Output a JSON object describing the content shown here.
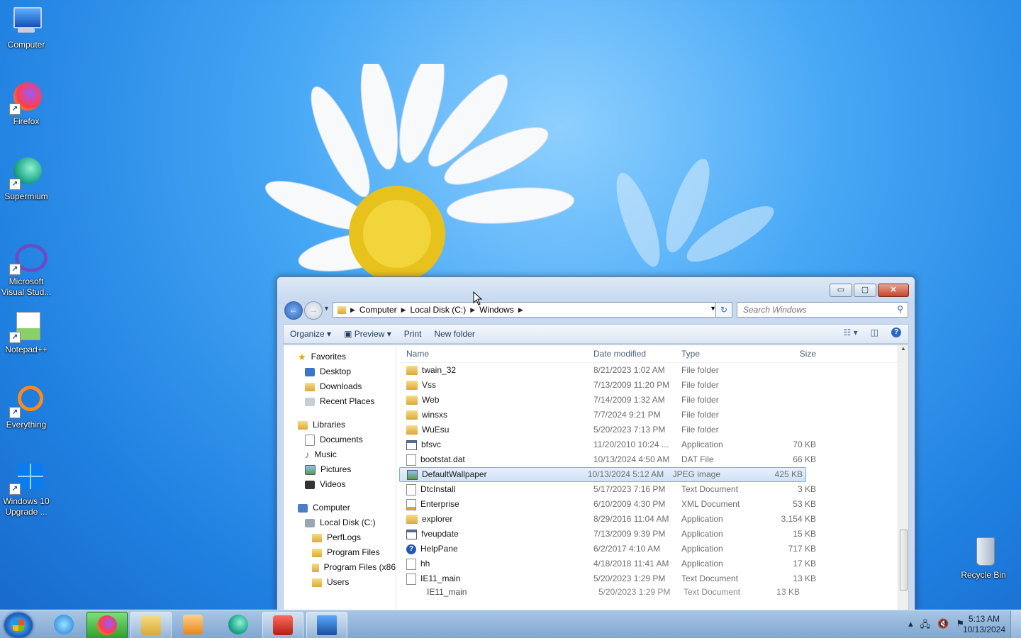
{
  "desktop": {
    "icons": [
      {
        "label": "Computer",
        "icon": "computer-icon"
      },
      {
        "label": "Firefox",
        "icon": "firefox-icon"
      },
      {
        "label": "Supermium",
        "icon": "supermium-icon"
      },
      {
        "label": "Microsoft Visual Stud...",
        "icon": "visual-studio-icon"
      },
      {
        "label": "Notepad++",
        "icon": "notepad-plus-plus-icon"
      },
      {
        "label": "Everything",
        "icon": "everything-search-icon"
      },
      {
        "label": "Windows 10 Upgrade ...",
        "icon": "windows-10-upgrade-icon"
      }
    ],
    "recycle_bin_label": "Recycle Bin"
  },
  "explorer": {
    "breadcrumb": [
      "Computer",
      "Local Disk (C:)",
      "Windows"
    ],
    "search_placeholder": "Search Windows",
    "toolbar": {
      "organize": "Organize ▾",
      "preview": "Preview ▾",
      "print": "Print",
      "new_folder": "New folder"
    },
    "window_buttons": {
      "minimize": "▭",
      "maximize": "▢",
      "close": "✕"
    },
    "nav": {
      "favorites": "Favorites",
      "desktop": "Desktop",
      "downloads": "Downloads",
      "recent": "Recent Places",
      "libraries": "Libraries",
      "documents": "Documents",
      "music": "Music",
      "pictures": "Pictures",
      "videos": "Videos",
      "computer": "Computer",
      "local_disk": "Local Disk (C:)",
      "perflogs": "PerfLogs",
      "program_files": "Program Files",
      "program_files_x86": "Program Files (x86",
      "users": "Users"
    },
    "columns": {
      "name": "Name",
      "date": "Date modified",
      "type": "Type",
      "size": "Size"
    },
    "files": [
      {
        "name": "twain_32",
        "date": "8/21/2023 1:02 AM",
        "type": "File folder",
        "size": "",
        "icon": "folder"
      },
      {
        "name": "Vss",
        "date": "7/13/2009 11:20 PM",
        "type": "File folder",
        "size": "",
        "icon": "folder"
      },
      {
        "name": "Web",
        "date": "7/14/2009 1:32 AM",
        "type": "File folder",
        "size": "",
        "icon": "folder"
      },
      {
        "name": "winsxs",
        "date": "7/7/2024 9:21 PM",
        "type": "File folder",
        "size": "",
        "icon": "folder"
      },
      {
        "name": "WuEsu",
        "date": "5/20/2023 7:13 PM",
        "type": "File folder",
        "size": "",
        "icon": "folder"
      },
      {
        "name": "bfsvc",
        "date": "11/20/2010 10:24 ...",
        "type": "Application",
        "size": "70 KB",
        "icon": "app"
      },
      {
        "name": "bootstat.dat",
        "date": "10/13/2024 4:50 AM",
        "type": "DAT File",
        "size": "66 KB",
        "icon": "doc"
      },
      {
        "name": "DefaultWallpaper",
        "date": "10/13/2024 5:12 AM",
        "type": "JPEG image",
        "size": "425 KB",
        "icon": "img",
        "selected": true
      },
      {
        "name": "DtcInstall",
        "date": "5/17/2023 7:16 PM",
        "type": "Text Document",
        "size": "3 KB",
        "icon": "doc"
      },
      {
        "name": "Enterprise",
        "date": "6/10/2009 4:30 PM",
        "type": "XML Document",
        "size": "53 KB",
        "icon": "xml"
      },
      {
        "name": "explorer",
        "date": "8/29/2016 11:04 AM",
        "type": "Application",
        "size": "3,154 KB",
        "icon": "folder"
      },
      {
        "name": "fveupdate",
        "date": "7/13/2009 9:39 PM",
        "type": "Application",
        "size": "15 KB",
        "icon": "app"
      },
      {
        "name": "HelpPane",
        "date": "6/2/2017 4:10 AM",
        "type": "Application",
        "size": "717 KB",
        "icon": "help"
      },
      {
        "name": "hh",
        "date": "4/18/2018 11:41 AM",
        "type": "Application",
        "size": "17 KB",
        "icon": "doc"
      },
      {
        "name": "IE11_main",
        "date": "5/20/2023 1:29 PM",
        "type": "Text Document",
        "size": "13 KB",
        "icon": "doc"
      }
    ],
    "drag_ghost": {
      "name": "IE11_main",
      "date": "5/20/2023 1:29 PM",
      "type": "Text Document",
      "size": "13 KB"
    }
  },
  "taskbar": {
    "apps": [
      "internet-explorer-icon",
      "firefox-icon",
      "file-explorer-icon",
      "media-player-icon",
      "supermium-icon",
      "toolbox-icon",
      "explorer-window-icon"
    ],
    "clock": {
      "time": "5:13 AM",
      "date": "10/13/2024"
    }
  },
  "colors": {
    "selected_row": "#cfe1f6",
    "taskbar": "#8fb2d8",
    "accent": "#2a6ac0"
  }
}
